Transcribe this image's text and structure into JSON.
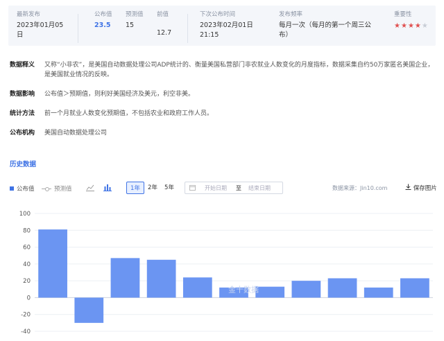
{
  "summary": {
    "latest_label": "最新发布",
    "latest_value": "2023年01月05日",
    "published_label": "公布值",
    "published_value": "23.5",
    "forecast_label": "预测值",
    "forecast_value": "15",
    "previous_label": "前值",
    "previous_value": "12.7",
    "next_label": "下次公布时间",
    "next_value": "2023年02月01日 21:15",
    "frequency_label": "发布频率",
    "frequency_value": "每月一次（每月的第一个周三公布）",
    "importance_label": "重要性",
    "importance_rating": 4,
    "importance_max": 5
  },
  "info": [
    {
      "key": "数据释义",
      "text": "又称“小非农”，是美国自动数据处理公司ADP统计的、衡量美国私营部门非农就业人数变化的月度指标，数据采集自约50万家匿名美国企业，是美国就业情况的反映。"
    },
    {
      "key": "数据影响",
      "text": "公布值＞预期值，则利好美国经济及美元，利空非美。"
    },
    {
      "key": "统计方法",
      "text": "前一个月就业人数变化预期值，不包括农业和政府工作人员。"
    },
    {
      "key": "公布机构",
      "text": "美国自动数据处理公司"
    }
  ],
  "history_title": "历史数据",
  "toolbar": {
    "legend_published": "公布值",
    "legend_expected": "预测值",
    "range_1y": "1年",
    "range_2y": "2年",
    "range_5y": "5年",
    "start_placeholder": "开始日期",
    "to_text": "至",
    "end_placeholder": "结束日期",
    "source": "数据来源：Jin10.com",
    "save": "保存图片"
  },
  "colors": {
    "accent": "#3f73e5",
    "bar": "#6b95f2",
    "star_on": "#e05050",
    "star_off": "#c8cdd6"
  },
  "icons": {
    "line_chart": "line-chart-icon",
    "bar_chart": "bar-chart-icon",
    "calendar": "calendar-icon",
    "download": "download-icon"
  },
  "chart_data": {
    "type": "bar",
    "series": [
      {
        "values": [
          81,
          -30,
          47,
          45,
          24,
          12,
          13,
          20,
          23,
          12,
          23
        ]
      }
    ],
    "yticks": [
      100,
      80,
      60,
      40,
      20,
      0,
      -20,
      -40
    ],
    "ylim": [
      -40,
      100
    ],
    "grid": true,
    "watermark": "金十数据"
  }
}
